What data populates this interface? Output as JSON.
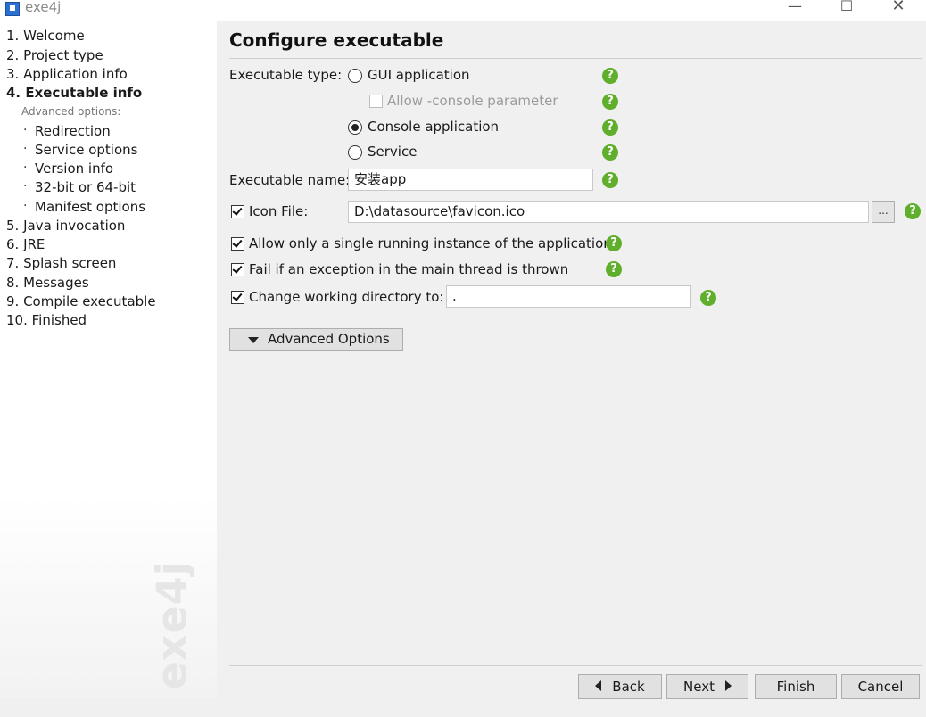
{
  "window": {
    "title": "exe4j",
    "minimize": "—",
    "maximize": "☐",
    "close": "✕"
  },
  "nav": {
    "steps": [
      "1. Welcome",
      "2. Project type",
      "3. Application info",
      "4. Executable info"
    ],
    "advanced_label": "Advanced options:",
    "bullet": "·",
    "sub_items": [
      "Redirection",
      "Service options",
      "Version info",
      "32-bit or 64-bit",
      "Manifest options"
    ],
    "steps_after": [
      "5. Java invocation",
      "6. JRE",
      "7. Splash screen",
      "8. Messages",
      "9. Compile executable",
      "10. Finished"
    ],
    "active_step": "4. Executable info",
    "watermark": "exe4j"
  },
  "main": {
    "title": "Configure executable",
    "executable_type_label": "Executable type:",
    "options": {
      "gui": "GUI application",
      "allow_console": "Allow -console parameter",
      "console": "Console application",
      "service": "Service"
    },
    "selected_type": "Console application",
    "executable_name_label": "Executable name:",
    "executable_name_value": "安装app",
    "icon_file_label": "Icon File:",
    "icon_file_value": "D:\\datasource\\favicon.ico",
    "browse_label": "...",
    "single_instance_label": "Allow only a single running instance of the application",
    "fail_exception_label": "Fail if an exception in the main thread is thrown",
    "change_dir_label": "Change working directory to:",
    "change_dir_value": ".",
    "help_glyph": "?",
    "advanced_button": "Advanced Options"
  },
  "footer": {
    "back": "Back",
    "next": "Next",
    "finish": "Finish",
    "cancel": "Cancel"
  },
  "colors": {
    "help_green": "#5fae2c",
    "background": "#f0f0f0"
  }
}
